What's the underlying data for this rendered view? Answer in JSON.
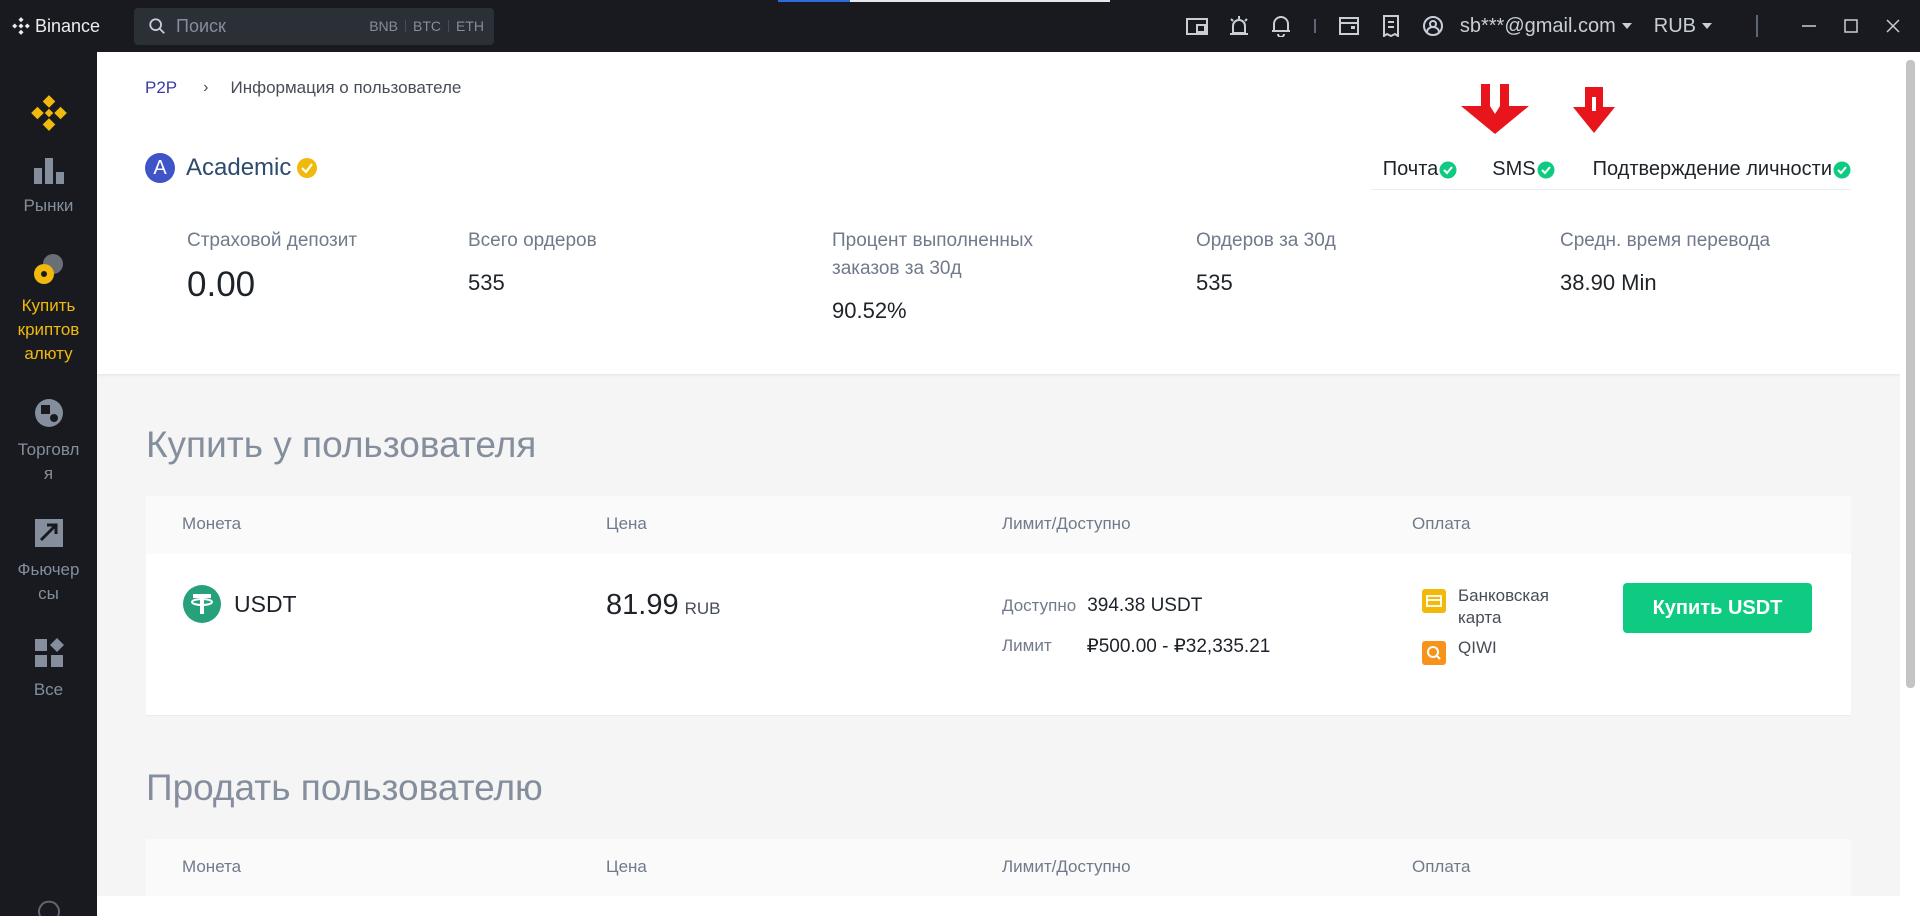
{
  "titlebar": {
    "brand": "Binance",
    "search_placeholder": "Поиск",
    "search_tags": [
      "BNB",
      "BTC",
      "ETH"
    ],
    "account": "sb***@gmail.com",
    "currency": "RUB",
    "icons": [
      "portfolio-icon",
      "alarm-icon",
      "bell-icon",
      "wallet-icon",
      "orders-icon",
      "profile-icon"
    ]
  },
  "sidebar": {
    "items": [
      {
        "label": "",
        "icon": "binance-logo-icon"
      },
      {
        "label": "Рынки",
        "icon": "markets-icon"
      },
      {
        "label": "Купить криптовалюту",
        "lines": [
          "Купить",
          "криптов",
          "алюту"
        ],
        "icon": "buy-crypto-icon",
        "active": true
      },
      {
        "label": "Торговля",
        "lines": [
          "Торговл",
          "я"
        ],
        "icon": "trade-icon"
      },
      {
        "label": "Фьючерсы",
        "lines": [
          "Фьючер",
          "сы"
        ],
        "icon": "futures-icon"
      },
      {
        "label": "Все",
        "icon": "all-icon"
      }
    ]
  },
  "breadcrumb": {
    "root": "P2P",
    "current": "Информация о пользователе"
  },
  "user": {
    "avatar_letter": "A",
    "name": "Academic"
  },
  "verification": {
    "items": [
      "Почта",
      "SMS",
      "Подтверждение личности"
    ],
    "check_color": "#0ecb81"
  },
  "stats": [
    {
      "label": "Страховой депозит",
      "value": "0.00"
    },
    {
      "label": "Всего ордеров",
      "value": "535"
    },
    {
      "label_lines": [
        "Процент выполненных",
        "заказов за 30д"
      ],
      "value": "90.52%"
    },
    {
      "label": "Ордеров за 30д",
      "value": "535"
    },
    {
      "label": "Средн. время перевода",
      "value": "38.90 Min"
    }
  ],
  "buy_section": {
    "title": "Купить у пользователя",
    "columns": [
      "Монета",
      "Цена",
      "Лимит/Доступно",
      "Оплата"
    ],
    "offer": {
      "coin": "USDT",
      "price": "81.99",
      "price_currency": "RUB",
      "available_label": "Доступно",
      "available_value": "394.38 USDT",
      "limit_label": "Лимит",
      "limit_value": "₽500.00 - ₽32,335.21",
      "payments": [
        {
          "lines": [
            "Банковская",
            "карта"
          ],
          "icon": "bank-card-icon",
          "color": "#f0b90b"
        },
        {
          "lines": [
            "QIWI"
          ],
          "icon": "qiwi-icon",
          "color": "#f7931a"
        }
      ],
      "button": "Купить USDT",
      "button_color": "#0ecb81"
    }
  },
  "sell_section": {
    "title": "Продать пользователю",
    "columns": [
      "Монета",
      "Цена",
      "Лимит/Доступно",
      "Оплата"
    ]
  },
  "annotations": {
    "arrow_color": "#e8161c"
  }
}
